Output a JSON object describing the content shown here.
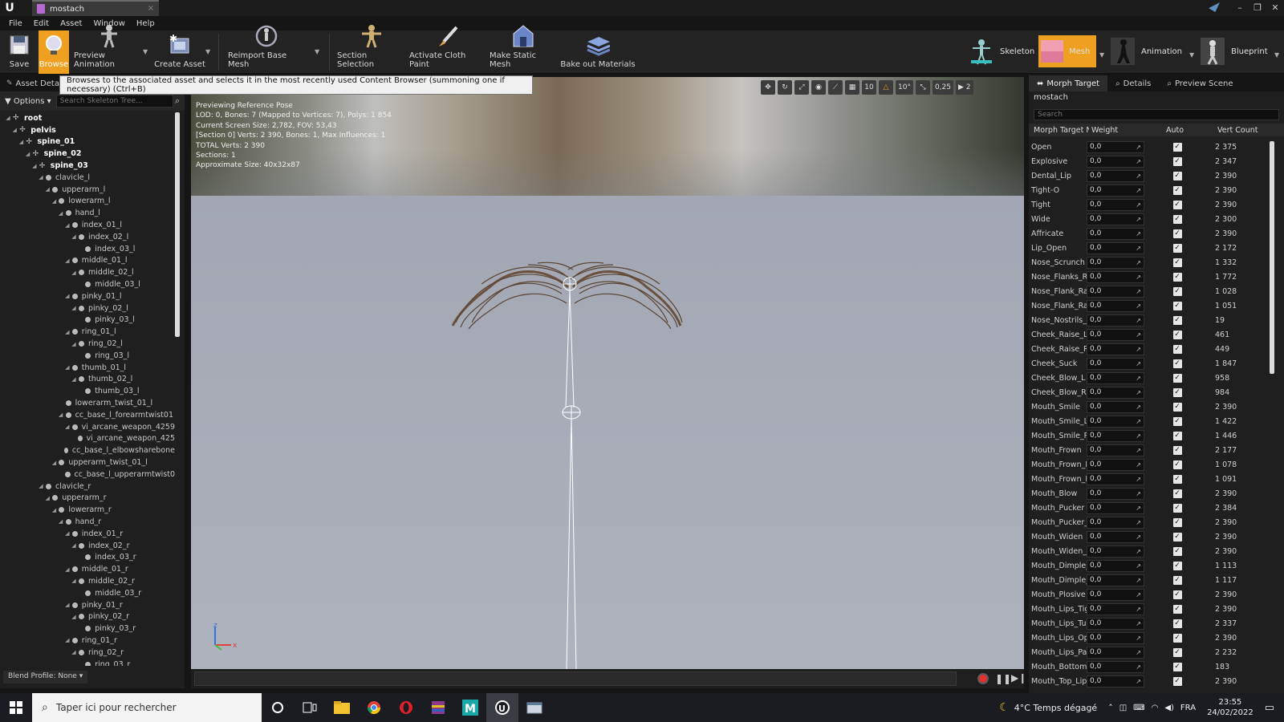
{
  "window": {
    "tab_title": "mostach"
  },
  "menu": [
    "File",
    "Edit",
    "Asset",
    "Window",
    "Help"
  ],
  "toolbar": {
    "buttons": [
      "Save",
      "Browse",
      "Preview Animation",
      "Create Asset",
      "Reimport Base Mesh",
      "Section Selection",
      "Activate Cloth Paint",
      "Make Static Mesh",
      "Bake out Materials"
    ],
    "modes": [
      "Skeleton",
      "Mesh",
      "Animation",
      "Blueprint"
    ]
  },
  "tooltip": "Browses to the associated asset and selects it in the most recently used Content Browser (summoning one if necessary) (Ctrl+B)",
  "left_panel": {
    "tab_label": "Asset Deta",
    "options_label": "Options",
    "search_placeholder": "Search Skeleton Tree...",
    "blend_profile": "Blend Profile: None"
  },
  "skeleton_tree": [
    {
      "name": "root",
      "depth": 0,
      "bold": true
    },
    {
      "name": "pelvis",
      "depth": 1,
      "bold": true
    },
    {
      "name": "spine_01",
      "depth": 2,
      "bold": true
    },
    {
      "name": "spine_02",
      "depth": 3,
      "bold": true
    },
    {
      "name": "spine_03",
      "depth": 4,
      "bold": true
    },
    {
      "name": "clavicle_l",
      "depth": 5
    },
    {
      "name": "upperarm_l",
      "depth": 6
    },
    {
      "name": "lowerarm_l",
      "depth": 7
    },
    {
      "name": "hand_l",
      "depth": 8
    },
    {
      "name": "index_01_l",
      "depth": 9
    },
    {
      "name": "index_02_l",
      "depth": 10
    },
    {
      "name": "index_03_l",
      "depth": 11,
      "leaf": true
    },
    {
      "name": "middle_01_l",
      "depth": 9
    },
    {
      "name": "middle_02_l",
      "depth": 10
    },
    {
      "name": "middle_03_l",
      "depth": 11,
      "leaf": true
    },
    {
      "name": "pinky_01_l",
      "depth": 9
    },
    {
      "name": "pinky_02_l",
      "depth": 10
    },
    {
      "name": "pinky_03_l",
      "depth": 11,
      "leaf": true
    },
    {
      "name": "ring_01_l",
      "depth": 9
    },
    {
      "name": "ring_02_l",
      "depth": 10
    },
    {
      "name": "ring_03_l",
      "depth": 11,
      "leaf": true
    },
    {
      "name": "thumb_01_l",
      "depth": 9
    },
    {
      "name": "thumb_02_l",
      "depth": 10
    },
    {
      "name": "thumb_03_l",
      "depth": 11,
      "leaf": true
    },
    {
      "name": "lowerarm_twist_01_l",
      "depth": 8,
      "leaf": true
    },
    {
      "name": "cc_base_l_forearmtwist01",
      "depth": 8
    },
    {
      "name": "vi_arcane_weapon_4259",
      "depth": 9
    },
    {
      "name": "vi_arcane_weapon_425",
      "depth": 10,
      "leaf": true
    },
    {
      "name": "cc_base_l_elbowsharebone",
      "depth": 8,
      "leaf": true
    },
    {
      "name": "upperarm_twist_01_l",
      "depth": 7
    },
    {
      "name": "cc_base_l_upperarmtwist0",
      "depth": 8,
      "leaf": true
    },
    {
      "name": "clavicle_r",
      "depth": 5
    },
    {
      "name": "upperarm_r",
      "depth": 6
    },
    {
      "name": "lowerarm_r",
      "depth": 7
    },
    {
      "name": "hand_r",
      "depth": 8
    },
    {
      "name": "index_01_r",
      "depth": 9
    },
    {
      "name": "index_02_r",
      "depth": 10
    },
    {
      "name": "index_03_r",
      "depth": 11,
      "leaf": true
    },
    {
      "name": "middle_01_r",
      "depth": 9
    },
    {
      "name": "middle_02_r",
      "depth": 10
    },
    {
      "name": "middle_03_r",
      "depth": 11,
      "leaf": true
    },
    {
      "name": "pinky_01_r",
      "depth": 9
    },
    {
      "name": "pinky_02_r",
      "depth": 10
    },
    {
      "name": "pinky_03_r",
      "depth": 11,
      "leaf": true
    },
    {
      "name": "ring_01_r",
      "depth": 9
    },
    {
      "name": "ring_02_r",
      "depth": 10
    },
    {
      "name": "ring_03_r",
      "depth": 11,
      "leaf": true
    }
  ],
  "viewport": {
    "info_lines": [
      "Previewing Reference Pose",
      "LOD: 0, Bones: 7 (Mapped to Vertices: 7), Polys: 1 854",
      "Current Screen Size: 2,782, FOV: 53,43",
      "[Section 0] Verts: 2 390, Bones: 1, Max Influences: 1",
      "TOTAL Verts: 2 390",
      "Sections: 1",
      "Approximate Size: 40x32x87"
    ],
    "toolbar_values": {
      "grid_snap": "10",
      "rot_snap": "10°",
      "scale_snap": "0,25",
      "camera_speed": "2"
    },
    "axis_labels": {
      "x": "x",
      "z": "z"
    }
  },
  "right_panel": {
    "tabs": [
      "Morph Target",
      "Details",
      "Preview Scene"
    ],
    "mesh_name": "mostach",
    "search_placeholder": "Search",
    "columns": [
      "Morph Target N",
      "Weight",
      "Auto",
      "Vert Count"
    ],
    "morph_targets": [
      {
        "name": "Open",
        "weight": "0,0",
        "count": "2 375"
      },
      {
        "name": "Explosive",
        "weight": "0,0",
        "count": "2 347"
      },
      {
        "name": "Dental_Lip",
        "weight": "0,0",
        "count": "2 390"
      },
      {
        "name": "Tight-O",
        "weight": "0,0",
        "count": "2 390"
      },
      {
        "name": "Tight",
        "weight": "0,0",
        "count": "2 390"
      },
      {
        "name": "Wide",
        "weight": "0,0",
        "count": "2 300"
      },
      {
        "name": "Affricate",
        "weight": "0,0",
        "count": "2 390"
      },
      {
        "name": "Lip_Open",
        "weight": "0,0",
        "count": "2 172"
      },
      {
        "name": "Nose_Scrunch",
        "weight": "0,0",
        "count": "1 332"
      },
      {
        "name": "Nose_Flanks_Ra",
        "weight": "0,0",
        "count": "1 772"
      },
      {
        "name": "Nose_Flank_Rai",
        "weight": "0,0",
        "count": "1 028"
      },
      {
        "name": "Nose_Flank_Rai",
        "weight": "0,0",
        "count": "1 051"
      },
      {
        "name": "Nose_Nostrils_F",
        "weight": "0,0",
        "count": "19"
      },
      {
        "name": "Cheek_Raise_L",
        "weight": "0,0",
        "count": "461"
      },
      {
        "name": "Cheek_Raise_R",
        "weight": "0,0",
        "count": "449"
      },
      {
        "name": "Cheek_Suck",
        "weight": "0,0",
        "count": "1 847"
      },
      {
        "name": "Cheek_Blow_L",
        "weight": "0,0",
        "count": "958"
      },
      {
        "name": "Cheek_Blow_R",
        "weight": "0,0",
        "count": "984"
      },
      {
        "name": "Mouth_Smile",
        "weight": "0,0",
        "count": "2 390"
      },
      {
        "name": "Mouth_Smile_L",
        "weight": "0,0",
        "count": "1 422"
      },
      {
        "name": "Mouth_Smile_R",
        "weight": "0,0",
        "count": "1 446"
      },
      {
        "name": "Mouth_Frown",
        "weight": "0,0",
        "count": "2 177"
      },
      {
        "name": "Mouth_Frown_L",
        "weight": "0,0",
        "count": "1 078"
      },
      {
        "name": "Mouth_Frown_R",
        "weight": "0,0",
        "count": "1 091"
      },
      {
        "name": "Mouth_Blow",
        "weight": "0,0",
        "count": "2 390"
      },
      {
        "name": "Mouth_Pucker",
        "weight": "0,0",
        "count": "2 384"
      },
      {
        "name": "Mouth_Pucker_C",
        "weight": "0,0",
        "count": "2 390"
      },
      {
        "name": "Mouth_Widen",
        "weight": "0,0",
        "count": "2 390"
      },
      {
        "name": "Mouth_Widen_S",
        "weight": "0,0",
        "count": "2 390"
      },
      {
        "name": "Mouth_Dimple_L",
        "weight": "0,0",
        "count": "1 113"
      },
      {
        "name": "Mouth_Dimple_F",
        "weight": "0,0",
        "count": "1 117"
      },
      {
        "name": "Mouth_Plosive",
        "weight": "0,0",
        "count": "2 390"
      },
      {
        "name": "Mouth_Lips_Tig",
        "weight": "0,0",
        "count": "2 390"
      },
      {
        "name": "Mouth_Lips_Tuc",
        "weight": "0,0",
        "count": "2 337"
      },
      {
        "name": "Mouth_Lips_Ope",
        "weight": "0,0",
        "count": "2 390"
      },
      {
        "name": "Mouth_Lips_Par",
        "weight": "0,0",
        "count": "2 232"
      },
      {
        "name": "Mouth_Bottom_",
        "weight": "0,0",
        "count": "183"
      },
      {
        "name": "Mouth_Top_Lip_",
        "weight": "0,0",
        "count": "2 390"
      }
    ]
  },
  "taskbar": {
    "search_placeholder": "Taper ici pour rechercher",
    "weather": "4°C  Temps dégagé",
    "language": "FRA",
    "time": "23:55",
    "date": "24/02/2022"
  },
  "colors": {
    "accent": "#f0a020",
    "panel": "#1f1f1f",
    "viewport_bg": "#a8acb6"
  }
}
